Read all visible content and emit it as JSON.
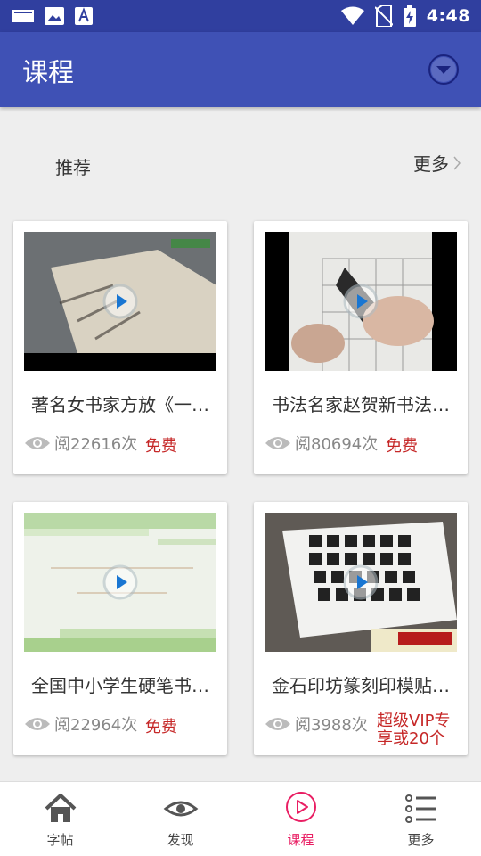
{
  "status_bar": {
    "time": "4:48",
    "icons": [
      "notification-icon",
      "image-icon",
      "font-icon",
      "wifi-icon",
      "no-sim-icon",
      "battery-charging-icon"
    ]
  },
  "app_bar": {
    "title": "课程",
    "dropdown_icon": "chevron-down-circle-icon"
  },
  "section": {
    "title": "推荐",
    "more": "更多"
  },
  "courses": [
    {
      "title": "著名女书家方放《一…",
      "views": "阅22616次",
      "price": "免费"
    },
    {
      "title": "书法名家赵贺新书法…",
      "views": "阅80694次",
      "price": "免费"
    },
    {
      "title": "全国中小学生硬笔书…",
      "views": "阅22964次",
      "price": "免费"
    },
    {
      "title": "金石印坊篆刻印模贴…",
      "views": "阅3988次",
      "price": "超级VIP专享或20个"
    }
  ],
  "bottom_nav": [
    {
      "label": "字帖",
      "icon": "home-icon"
    },
    {
      "label": "发现",
      "icon": "eye-icon"
    },
    {
      "label": "课程",
      "icon": "play-circle-icon",
      "active": true
    },
    {
      "label": "更多",
      "icon": "list-icon"
    }
  ],
  "colors": {
    "status_bar": "#303f9f",
    "app_bar": "#3f51b5",
    "accent": "#e91e63",
    "price": "#c62828",
    "background": "#eeeeee"
  }
}
